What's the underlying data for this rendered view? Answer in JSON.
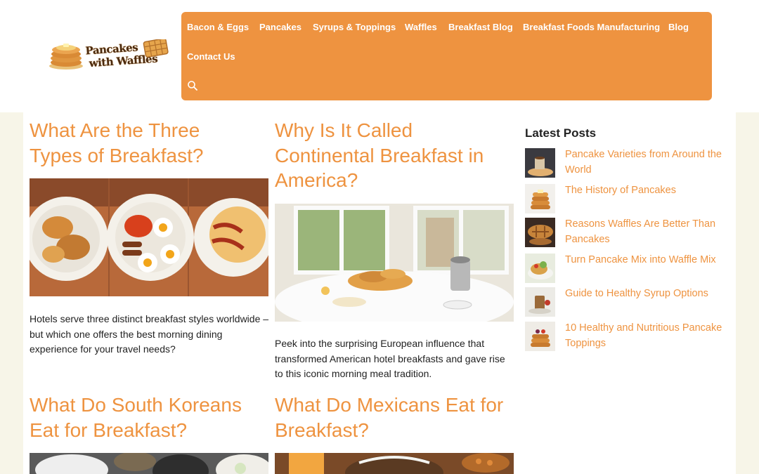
{
  "site": {
    "logo_line1": "Pancakes",
    "logo_line2": "with Waffles"
  },
  "nav": {
    "items": [
      "Bacon & Eggs",
      "Pancakes",
      "Syrups & Toppings",
      "Waffles",
      "Breakfast Blog",
      "Breakfast Foods Manufacturing",
      "Blog",
      "Contact Us"
    ],
    "search_icon": "search-icon"
  },
  "posts": [
    {
      "title": "What Are the Three Types of Breakfast?",
      "excerpt": "Hotels serve three distinct breakfast styles worldwide – but which one offers the best morning dining experience for your travel needs?"
    },
    {
      "title": "Why Is It Called Continental Breakfast in America?",
      "excerpt": "Peek into the surprising European influence that transformed American hotel breakfasts and gave rise to this iconic morning meal tradition."
    },
    {
      "title": "What Do South Koreans Eat for Breakfast?"
    },
    {
      "title": "What Do Mexicans Eat for Breakfast?"
    }
  ],
  "sidebar": {
    "title": "Latest Posts",
    "items": [
      "Pancake Varieties from Around the World",
      "The History of Pancakes",
      "Reasons Waffles Are Better Than Pancakes",
      "Turn Pancake Mix into Waffle Mix",
      "Guide to Healthy Syrup Options",
      "10 Healthy and Nutritious Pancake Toppings"
    ]
  },
  "colors": {
    "accent": "#ee9340",
    "page_bg": "#f7f5e8",
    "content_bg": "#ffffff"
  }
}
